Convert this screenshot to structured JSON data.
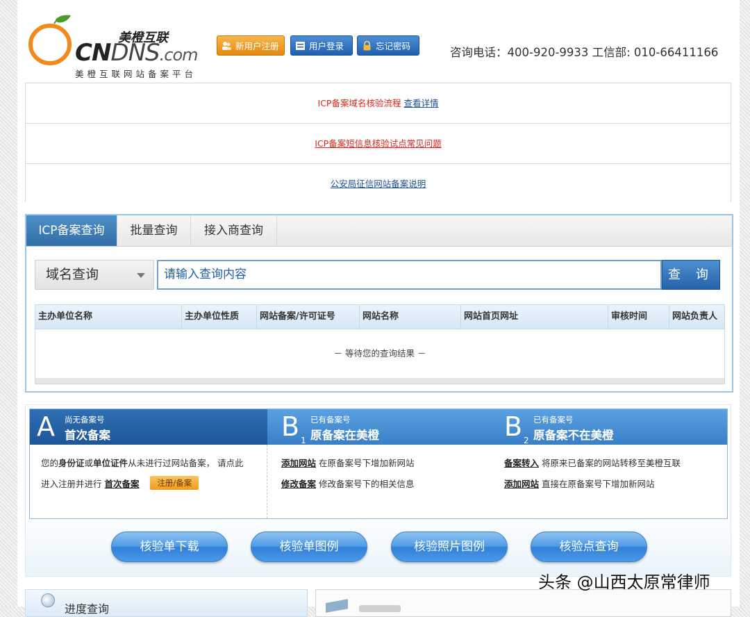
{
  "header": {
    "brand_cn": "美橙互联",
    "brand_en_cn": "CN",
    "brand_en_dns": "DNS",
    "brand_en_com": ".com",
    "brand_subtitle": "美橙互联网站备案平台",
    "buttons": {
      "register": "新用户注册",
      "login": "用户登录",
      "forgot": "忘记密码"
    },
    "contact": "咨询电话：400-920-9933 工信部: 010-66411166"
  },
  "notices": [
    {
      "text": "ICP备案域名核验流程",
      "link": "查看详情"
    },
    {
      "link": "ICP备案短信息核验试点常见问题"
    },
    {
      "link": "公安局征信网站备案说明"
    }
  ],
  "query": {
    "tabs": [
      "ICP备案查询",
      "批量查询",
      "接入商查询"
    ],
    "select_value": "域名查询",
    "search_placeholder": "请输入查询内容",
    "search_button": "查 询",
    "columns": [
      "主办单位名称",
      "主办单位性质",
      "网站备案/许可证号",
      "网站名称",
      "网站首页网址",
      "审核时间",
      "网站负责人"
    ],
    "empty_text": "－ 等待您的查询结果 －"
  },
  "filing": {
    "a": {
      "letter": "A",
      "small": "尚无备案号",
      "title": "首次备案",
      "line1_pre": "您的",
      "line1_b1": "身份证",
      "line1_mid": "或",
      "line1_b2": "单位证件",
      "line1_post": "从未进行过网站备案，  请点此",
      "line2_pre": "进入注册并进行",
      "line2_link": "首次备案",
      "tag": "注册/备案"
    },
    "b1": {
      "letter": "B",
      "sub": "1",
      "small": "已有备案号",
      "title": "原备案在美橙",
      "item1_link": "添加网站",
      "item1_text": "在原备案号下增加新网站",
      "item2_link": "修改备案",
      "item2_text": "修改备案号下的相关信息"
    },
    "b2": {
      "letter": "B",
      "sub": "2",
      "small": "已有备案号",
      "title": "原备案不在美橙",
      "item1_link": "备案转入",
      "item1_text": "将原来已备案的网站转移至美橙互联",
      "item2_link": "添加网站",
      "item2_text": "直接在原备案号下增加新网站"
    },
    "buttons": [
      "核验单下载",
      "核验单图例",
      "核验照片图例",
      "核验点查询"
    ]
  },
  "bottom": {
    "left_label": "进度查询"
  },
  "watermark": "头条 @山西太原常律师",
  "colors": {
    "accent_blue": "#316ea8",
    "orange": "#f29b1a",
    "red": "#d9261c"
  }
}
